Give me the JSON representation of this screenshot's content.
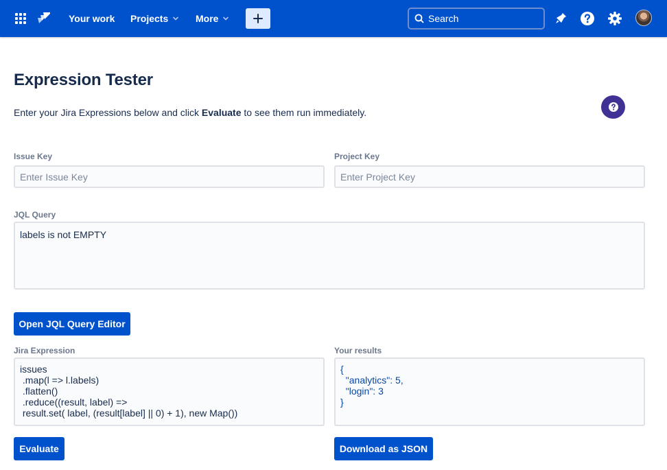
{
  "nav": {
    "your_work": "Your work",
    "projects": "Projects",
    "more": "More",
    "search_placeholder": "Search",
    "brand_color": "#0052cc"
  },
  "page": {
    "title": "Expression Tester",
    "intro_before": "Enter your Jira Expressions below and click ",
    "intro_bold": "Evaluate",
    "intro_after": " to see them run immediately."
  },
  "form": {
    "issue_key_label": "Issue Key",
    "issue_key_placeholder": "Enter Issue Key",
    "project_key_label": "Project Key",
    "project_key_placeholder": "Enter Project Key",
    "jql_label": "JQL Query",
    "jql_value": "labels is not EMPTY",
    "open_jql_editor": "Open JQL Query Editor",
    "expression_label": "Jira Expression",
    "expression_value": "issues\n .map(l => l.labels)\n .flatten()\n .reduce((result, label) =>\n result.set( label, (result[label] || 0) + 1), new Map())",
    "results_label": "Your results",
    "results_value": "{\n  \"analytics\": 5,\n  \"login\": 3\n}",
    "evaluate": "Evaluate",
    "download": "Download as JSON"
  },
  "icons": {
    "apps": "app-switcher-icon",
    "logo": "jira-logo-icon",
    "search": "search-icon",
    "notifications": "notification-icon",
    "help": "help-icon",
    "settings": "gear-icon"
  }
}
